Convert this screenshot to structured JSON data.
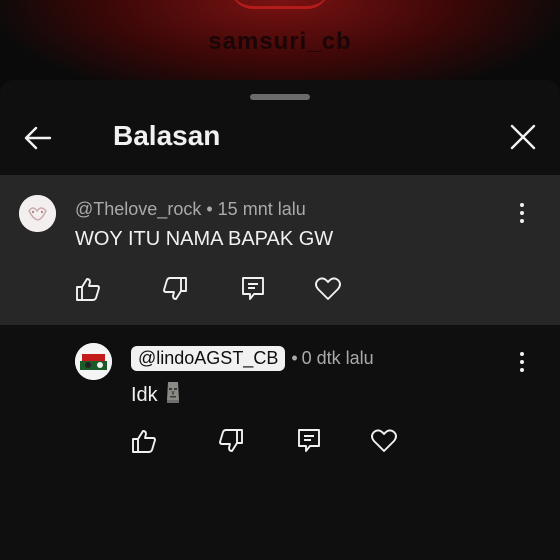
{
  "video": {
    "channel_watermark": "samsuri_cb"
  },
  "sheet": {
    "title": "Balasan",
    "back_icon": "arrow-left-icon",
    "close_icon": "close-icon"
  },
  "parent_comment": {
    "author": "@Thelove_rock",
    "separator": "•",
    "time": "15 mnt lalu",
    "text": "WOY ITU NAMA BAPAK GW",
    "actions": [
      "like-icon",
      "dislike-icon",
      "reply-icon",
      "heart-icon"
    ]
  },
  "reply_comment": {
    "mention": "@lindoAGST_CB",
    "separator": "•",
    "time": "0 dtk lalu",
    "text": "Idk",
    "emoji_icon": "moai-icon",
    "actions": [
      "like-icon",
      "dislike-icon",
      "reply-icon",
      "heart-icon"
    ]
  },
  "colors": {
    "background": "#0f0f0f",
    "highlight": "#272727",
    "text": "#f1f1f1",
    "meta": "#aaaaaa",
    "accent": "#b41c1c"
  }
}
